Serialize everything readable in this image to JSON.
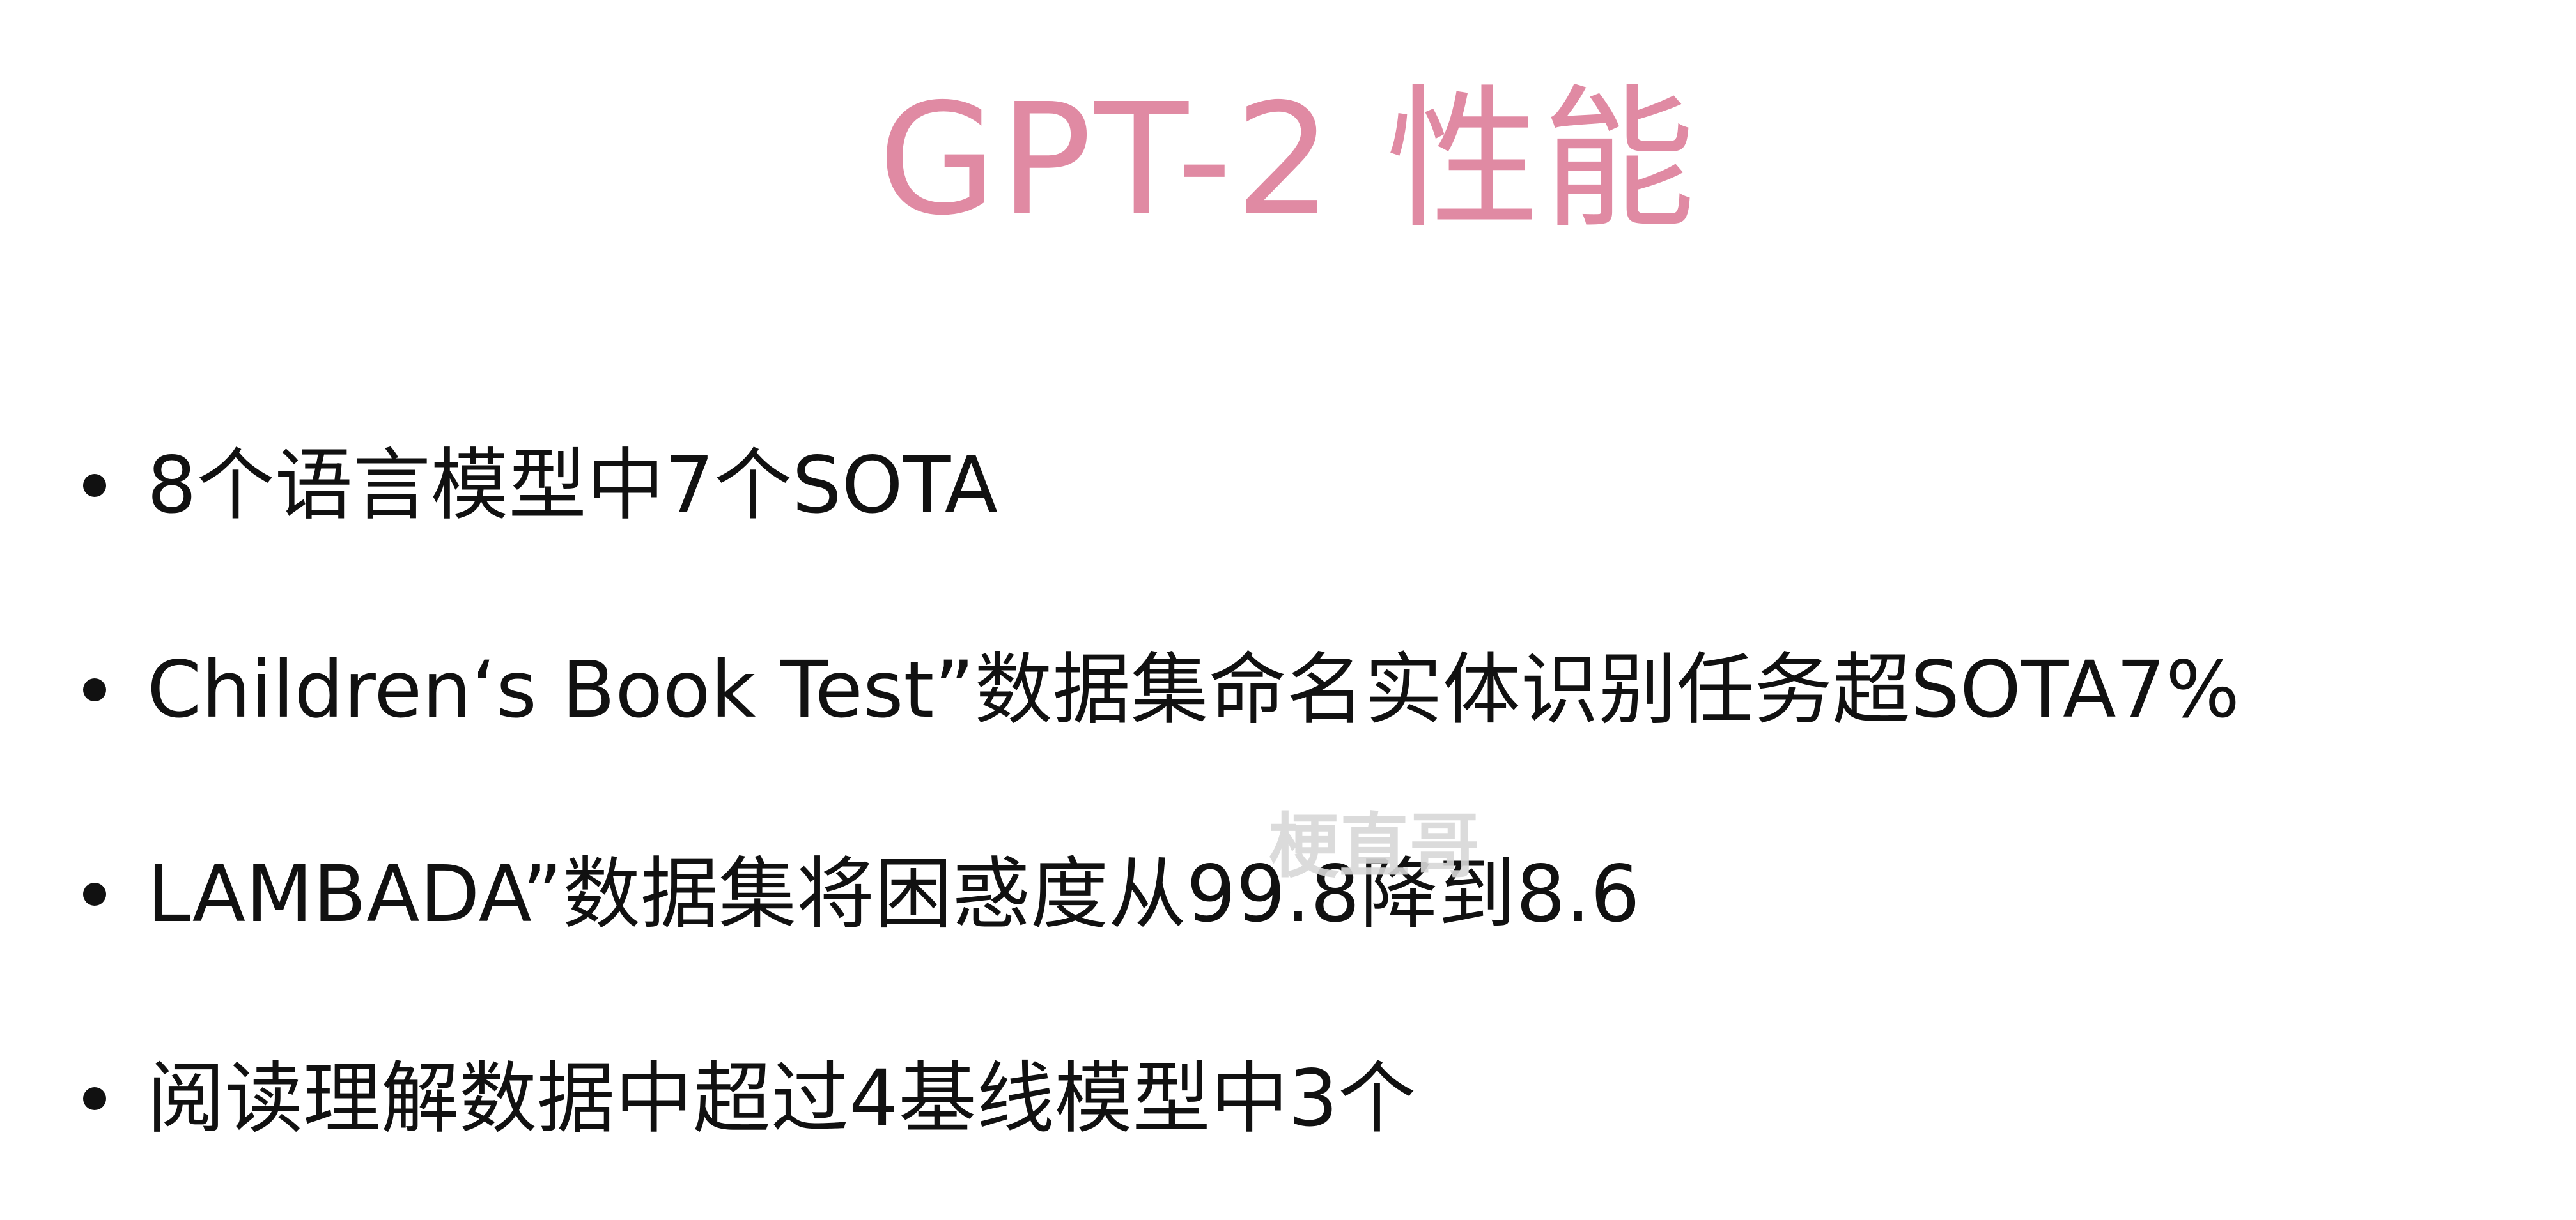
{
  "slide": {
    "title": "GPT-2 性能",
    "bullets": [
      "8个语言模型中7个SOTA",
      "Children‘s Book Test”数据集命名实体识别任务超SOTA7%",
      "LAMBADA”数据集将困惑度从99.8降到8.6",
      "阅读理解数据中超过4基线模型中3个"
    ],
    "watermark": "梗直哥"
  },
  "colors": {
    "title": "#e08aa3",
    "text": "#111111",
    "background": "#ffffff",
    "watermark": "#d8d8d8"
  }
}
